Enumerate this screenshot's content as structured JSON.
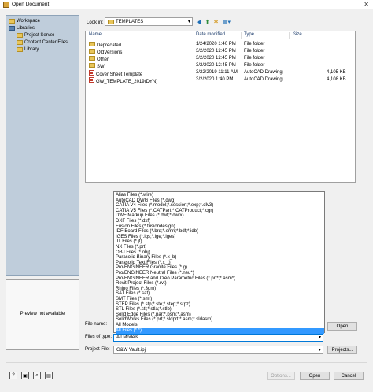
{
  "window": {
    "title": "Open Document",
    "icon": "app-icon",
    "close_glyph": "✕"
  },
  "tree": {
    "items": [
      {
        "label": "Workspace",
        "icon": "folder-icon"
      },
      {
        "label": "Libraries",
        "icon": "library-icon"
      },
      {
        "label": "Project Server",
        "icon": "folder-icon"
      },
      {
        "label": "Content Center Files",
        "icon": "folder-icon"
      },
      {
        "label": "Library",
        "icon": "folder-icon"
      }
    ]
  },
  "preview": {
    "text": "Preview not available"
  },
  "lookin": {
    "label": "Look in:",
    "value": "TEMPLATES",
    "dropdown_glyph": "▾"
  },
  "toolbar": {
    "back_glyph": "◀",
    "up_glyph": "⬆",
    "new_folder_glyph": "✱",
    "views_glyph": "▦▾"
  },
  "filelist": {
    "columns": [
      "Name",
      "Date modified",
      "Type",
      "Size"
    ],
    "rows": [
      {
        "name": "Deprecated",
        "date": "1/24/2020 1:40 PM",
        "type": "File folder",
        "size": "",
        "icon": "folder-icon"
      },
      {
        "name": "OldVersions",
        "date": "3/2/2020 12:45 PM",
        "type": "File folder",
        "size": "",
        "icon": "folder-icon"
      },
      {
        "name": "Other",
        "date": "3/2/2020 12:45 PM",
        "type": "File folder",
        "size": "",
        "icon": "folder-icon"
      },
      {
        "name": "SW",
        "date": "3/2/2020 12:45 PM",
        "type": "File folder",
        "size": "",
        "icon": "folder-icon"
      },
      {
        "name": "Cover Sheet Template",
        "date": "3/22/2019 11:11 AM",
        "type": "AutoCAD Drawing",
        "size": "4,105 KB",
        "icon": "dwg-icon"
      },
      {
        "name": "GW_TEMPLATE_2019(DYN)",
        "date": "3/2/2020 1:40 PM",
        "type": "AutoCAD Drawing",
        "size": "4,108 KB",
        "icon": "dwg-icon"
      }
    ]
  },
  "filetype_options": [
    "Alias Files (*.wire)",
    "AutoCAD DWG Files (*.dwg)",
    "CATIA V4 Files (*.model;*.session;*.exp;*.dlv3)",
    "CATIA V5 Files (*.CATPart;*.CATProduct;*.cgr)",
    "DWF Markup Files (*.dwf;*.dwfx)",
    "DXF Files (*.dxf)",
    "Fusion Files (*.fusiondesign)",
    "IDF Board Files (*.brd;*.emn;*.bdf;*.idb)",
    "IGES Files (*.igs;*.ige;*.iges)",
    "JT Files (*.jt)",
    "NX Files (*.prt)",
    "OBJ Files (*.obj)",
    "Parasolid Binary Files (*.x_b)",
    "Parasolid Text Files (*.x_t)",
    "Pro/ENGINEER Granite Files (*.g)",
    "Pro/ENGINEER Neutral Files (*.neu*)",
    "Pro/ENGINEER and Creo Parametric Files (*.prt*;*.asm*)",
    "Revit Project Files (*.rvt)",
    "Rhino Files (*.3dm)",
    "SAT Files (*.sat)",
    "SMT Files (*.smt)",
    "STEP Files (*.stp;*.ste;*.step;*.stpz)",
    "STL Files (*.stl;*.stla;*.stlb)",
    "Solid Edge Files (*.par;*.psm;*.asm)",
    "SolidWorks Files (*.prt;*.sldprt;*.asm;*.sldasm)",
    "All Models",
    "All Files (*.*)"
  ],
  "filetype_selected_index": 26,
  "form": {
    "filename_label": "File name:",
    "filetype_label": "Files of type:",
    "filetype_value": "All Models",
    "project_label": "Project File:",
    "project_value": "G&W Vault.ipj",
    "projects_button": "Projects...",
    "dropdown_glyph": "▾"
  },
  "buttons": {
    "open": "Open",
    "options": "Options...",
    "open_main": "Open",
    "cancel": "Cancel"
  },
  "footer_icons": [
    "help-icon",
    "workspace-icon",
    "find-icon",
    "vault-icon"
  ]
}
